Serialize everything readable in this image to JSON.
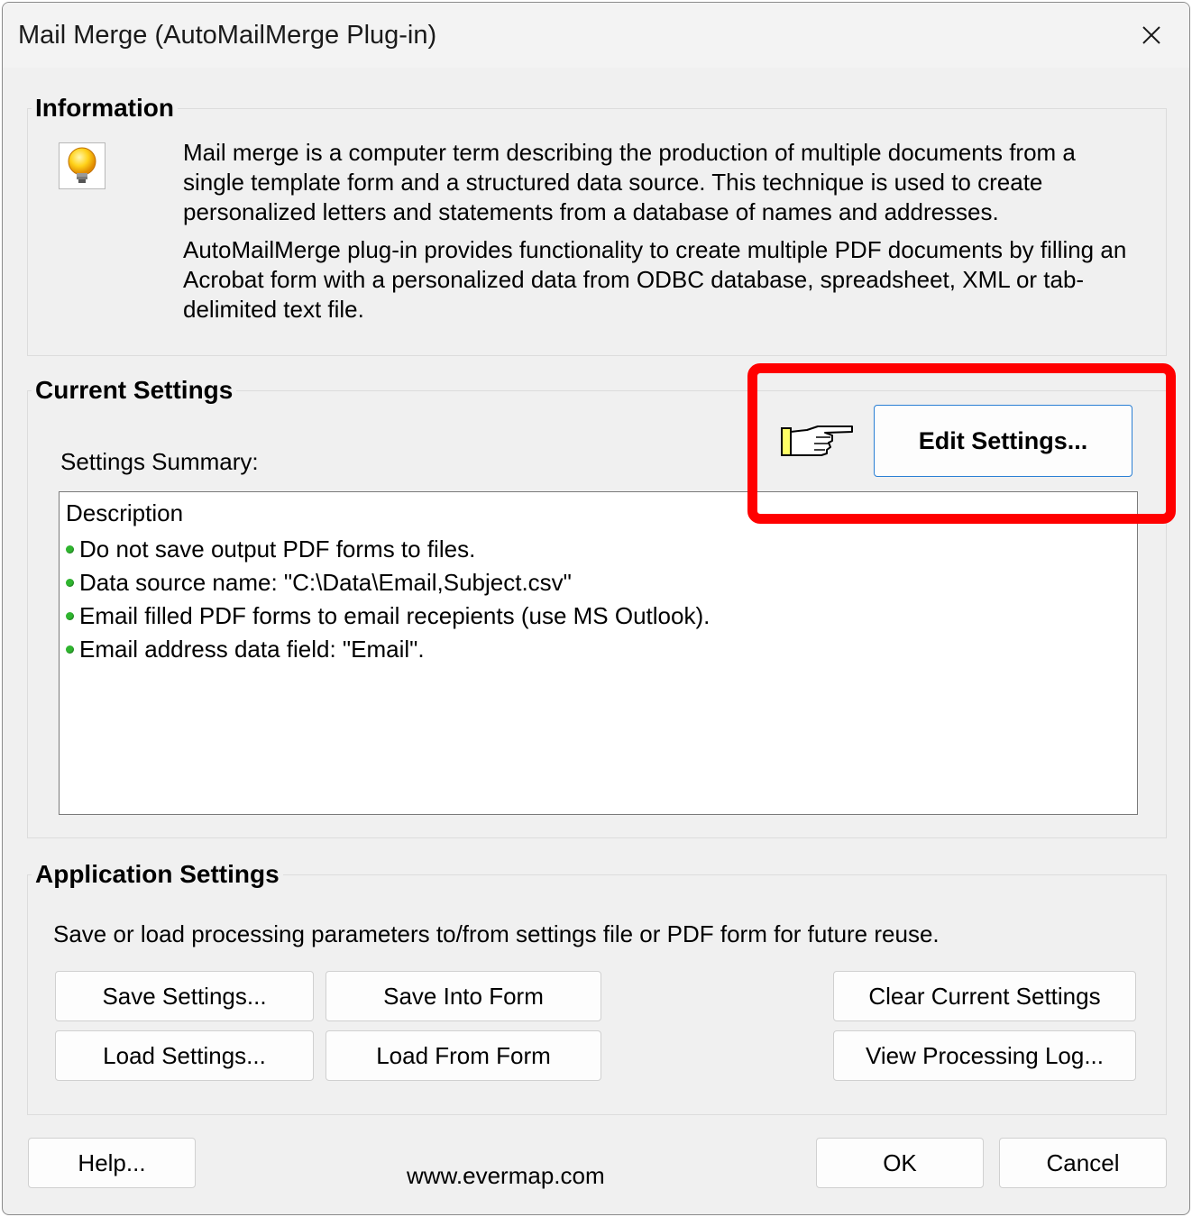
{
  "window": {
    "title": "Mail Merge (AutoMailMerge Plug-in)",
    "close_icon": "close-icon"
  },
  "information": {
    "label": "Information",
    "icon": "lightbulb-icon",
    "paragraph1": "Mail merge is a computer term describing the production of multiple documents from a single template form and a structured data source. This technique is used to create personalized letters and statements from a database of names and addresses.",
    "paragraph2": "AutoMailMerge plug-in provides functionality to create multiple PDF documents by filling an Acrobat form with a personalized data from ODBC database, spreadsheet, XML or tab-delimited text file."
  },
  "current_settings": {
    "label": "Current Settings",
    "summary_label": "Settings Summary:",
    "pointer_icon": "pointing-hand-icon",
    "edit_button": "Edit Settings...",
    "highlight_color": "#ff0000",
    "summary": {
      "header": "Description",
      "items": [
        "Do not save output PDF forms to files.",
        "Data source name: \"C:\\Data\\Email,Subject.csv\"",
        "Email filled PDF forms to email recepients (use MS Outlook).",
        "Email address data field: \"Email\"."
      ],
      "bullet_color": "#2fb52f"
    }
  },
  "application_settings": {
    "label": "Application Settings",
    "description": "Save or load processing parameters to/from settings file or PDF form for future reuse.",
    "buttons": {
      "save_settings": "Save Settings...",
      "save_into_form": "Save Into Form",
      "clear_current": "Clear Current Settings",
      "load_settings": "Load Settings...",
      "load_from_form": "Load From Form",
      "view_log": "View Processing Log..."
    }
  },
  "footer": {
    "help": "Help...",
    "website": "www.evermap.com",
    "ok": "OK",
    "cancel": "Cancel"
  }
}
